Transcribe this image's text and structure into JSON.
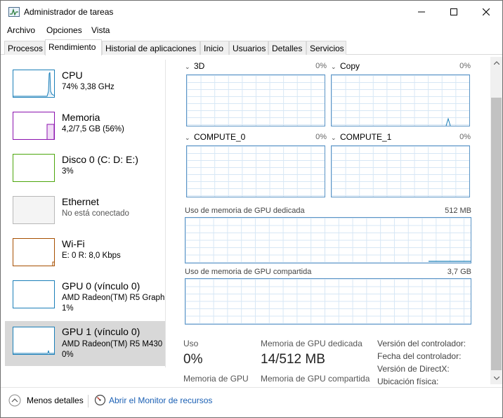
{
  "window": {
    "title": "Administrador de tareas"
  },
  "menu": [
    "Archivo",
    "Opciones",
    "Vista"
  ],
  "tabs": [
    {
      "label": "Procesos",
      "active": false
    },
    {
      "label": "Rendimiento",
      "active": true
    },
    {
      "label": "Historial de aplicaciones",
      "active": false
    },
    {
      "label": "Inicio",
      "active": false
    },
    {
      "label": "Usuarios",
      "active": false
    },
    {
      "label": "Detalles",
      "active": false
    },
    {
      "label": "Servicios",
      "active": false
    }
  ],
  "sidebar": {
    "items": [
      {
        "name": "CPU",
        "sub": "74%  3,38 GHz",
        "color": "#1b7fb8"
      },
      {
        "name": "Memoria",
        "sub": "4,2/7,5 GB (56%)",
        "color": "#8b12ae"
      },
      {
        "name": "Disco 0 (C: D: E:)",
        "sub": "3%",
        "color": "#4da60c"
      },
      {
        "name": "Ethernet",
        "sub": "No está conectado",
        "color": "#b0b0b0"
      },
      {
        "name": "Wi-Fi",
        "sub": "E: 0 R: 8,0 Kbps",
        "color": "#a74f01"
      },
      {
        "name": "GPU 0 (vínculo 0)",
        "sub": "AMD Radeon(TM) R5 Graph",
        "sub2": "1%",
        "color": "#1b7fb8"
      },
      {
        "name": "GPU 1 (vínculo 0)",
        "sub": "AMD Radeon(TM) R5 M430",
        "sub2": "0%",
        "color": "#1b7fb8"
      }
    ]
  },
  "graphs": {
    "g3d": {
      "label": "3D",
      "pct": "0%"
    },
    "copy": {
      "label": "Copy",
      "pct": "0%"
    },
    "compute0": {
      "label": "COMPUTE_0",
      "pct": "0%"
    },
    "compute1": {
      "label": "COMPUTE_1",
      "pct": "0%"
    },
    "dedicated": {
      "label": "Uso de memoria de GPU dedicada",
      "max": "512 MB"
    },
    "shared": {
      "label": "Uso de memoria de GPU compartida",
      "max": "3,7 GB"
    }
  },
  "stats": {
    "usage_label": "Uso",
    "usage_value": "0%",
    "dedicated_label": "Memoria de GPU dedicada",
    "dedicated_value": "14/512 MB",
    "gpu_mem_label": "Memoria de GPU",
    "shared_label": "Memoria de GPU compartida"
  },
  "info": {
    "driver_version": "Versión del controlador:",
    "driver_date": "Fecha del controlador:",
    "directx": "Versión de DirectX:",
    "location": "Ubicación física:"
  },
  "footer": {
    "less_details": "Menos detalles",
    "open_monitor": "Abrir el Monitor de recursos"
  },
  "colors": {
    "accent": "#1b7fb8",
    "link": "#1a5fb4",
    "selected_bg": "#d8d8d8"
  }
}
